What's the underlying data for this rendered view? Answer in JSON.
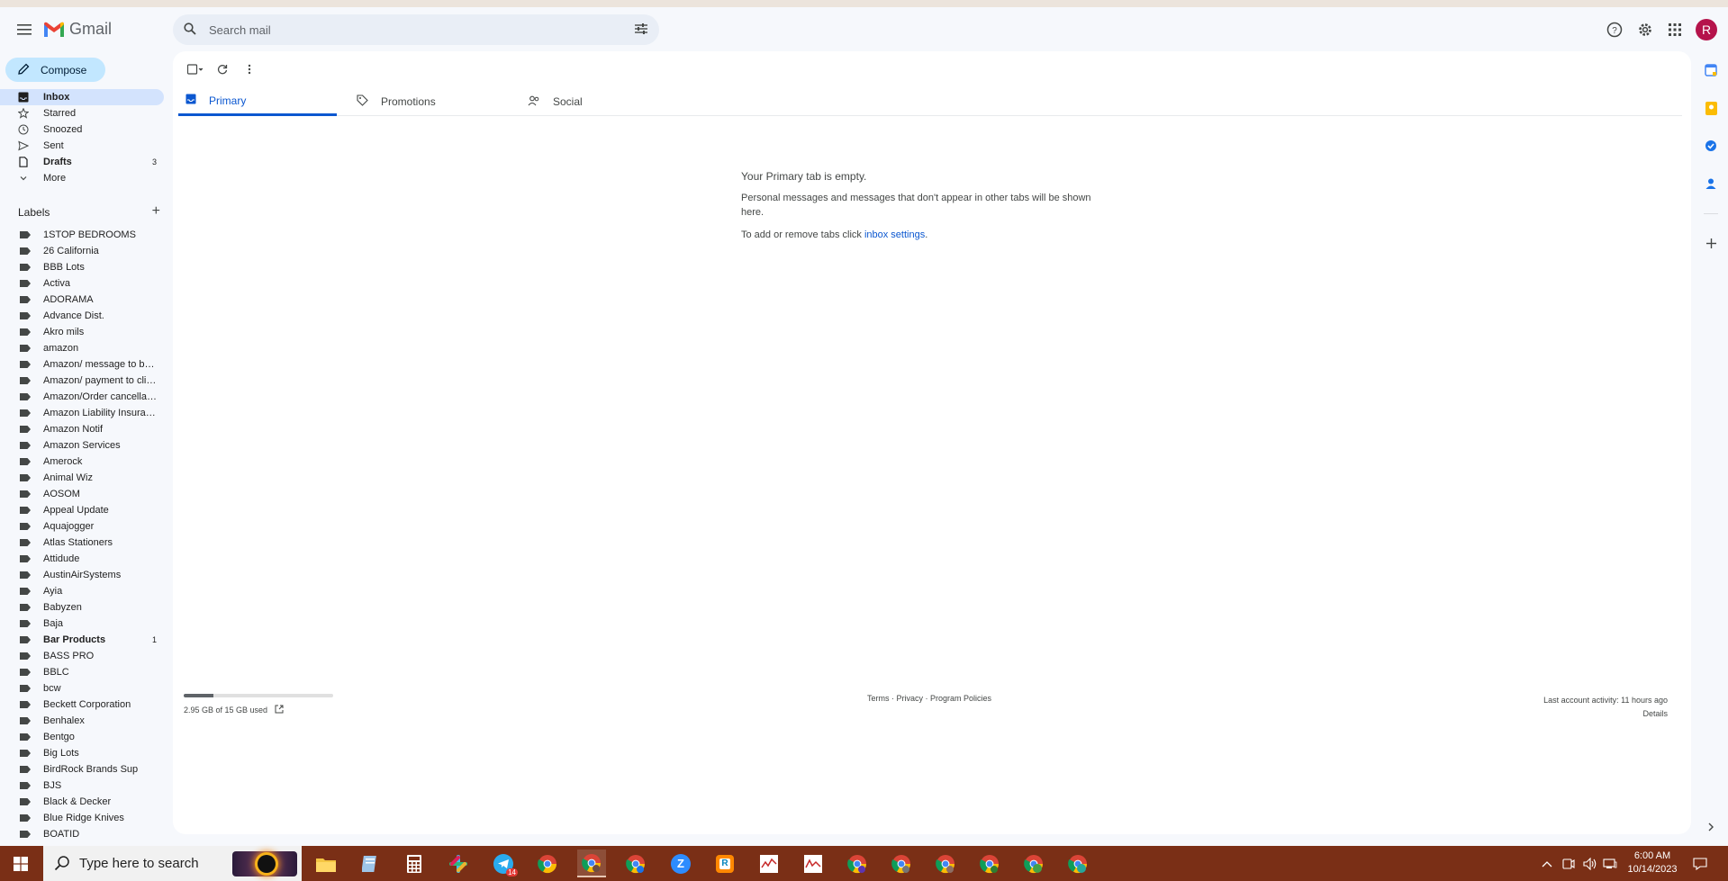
{
  "app": {
    "name": "Gmail"
  },
  "search": {
    "placeholder": "Search mail"
  },
  "compose": {
    "label": "Compose"
  },
  "nav": {
    "items": [
      {
        "label": "Inbox",
        "icon": "inbox-icon",
        "count": ""
      },
      {
        "label": "Starred",
        "icon": "star-icon",
        "count": ""
      },
      {
        "label": "Snoozed",
        "icon": "clock-icon",
        "count": ""
      },
      {
        "label": "Sent",
        "icon": "send-icon",
        "count": ""
      },
      {
        "label": "Drafts",
        "icon": "file-icon",
        "count": "3"
      },
      {
        "label": "More",
        "icon": "chevron-down-icon",
        "count": ""
      }
    ]
  },
  "labels": {
    "title": "Labels",
    "items": [
      {
        "label": "1STOP BEDROOMS",
        "count": ""
      },
      {
        "label": "26 California",
        "count": ""
      },
      {
        "label": "BBB Lots",
        "count": ""
      },
      {
        "label": "Activa",
        "count": ""
      },
      {
        "label": "ADORAMA",
        "count": ""
      },
      {
        "label": "Advance Dist.",
        "count": ""
      },
      {
        "label": "Akro mils",
        "count": ""
      },
      {
        "label": "amazon",
        "count": ""
      },
      {
        "label": "Amazon/ message to buyer",
        "count": ""
      },
      {
        "label": "Amazon/ payment to client",
        "count": ""
      },
      {
        "label": "Amazon/Order cancellation",
        "count": ""
      },
      {
        "label": "Amazon Liability Insurance",
        "count": ""
      },
      {
        "label": "Amazon Notif",
        "count": ""
      },
      {
        "label": "Amazon Services",
        "count": ""
      },
      {
        "label": "Amerock",
        "count": ""
      },
      {
        "label": "Animal Wiz",
        "count": ""
      },
      {
        "label": "AOSOM",
        "count": ""
      },
      {
        "label": "Appeal Update",
        "count": ""
      },
      {
        "label": "Aquajogger",
        "count": ""
      },
      {
        "label": "Atlas Stationers",
        "count": ""
      },
      {
        "label": "Attidude",
        "count": ""
      },
      {
        "label": "AustinAirSystems",
        "count": ""
      },
      {
        "label": "Ayia",
        "count": ""
      },
      {
        "label": "Babyzen",
        "count": ""
      },
      {
        "label": "Baja",
        "count": ""
      },
      {
        "label": "Bar Products",
        "count": "1"
      },
      {
        "label": "BASS PRO",
        "count": ""
      },
      {
        "label": "BBLC",
        "count": ""
      },
      {
        "label": "bcw",
        "count": ""
      },
      {
        "label": "Beckett Corporation",
        "count": ""
      },
      {
        "label": "Benhalex",
        "count": ""
      },
      {
        "label": "Bentgo",
        "count": ""
      },
      {
        "label": "Big Lots",
        "count": ""
      },
      {
        "label": "BirdRock Brands Sup",
        "count": ""
      },
      {
        "label": "BJS",
        "count": ""
      },
      {
        "label": "Black & Decker",
        "count": ""
      },
      {
        "label": "Blue Ridge Knives",
        "count": ""
      },
      {
        "label": "BOATID",
        "count": ""
      }
    ]
  },
  "tabs": [
    {
      "label": "Primary"
    },
    {
      "label": "Promotions"
    },
    {
      "label": "Social"
    }
  ],
  "empty": {
    "title": "Your Primary tab is empty.",
    "line1": "Personal messages and messages that don't appear in other tabs will be shown here.",
    "line2_prefix": "To add or remove tabs click ",
    "line2_link": "inbox settings",
    "line2_suffix": "."
  },
  "footer": {
    "storage_text": "2.95 GB of 15 GB used",
    "storage_fraction": 0.197,
    "links": "Terms · Privacy · Program Policies",
    "last_activity": "Last account activity: 11 hours ago",
    "details": "Details"
  },
  "avatar": {
    "initial": "R"
  },
  "taskbar": {
    "search_placeholder": "Type here to search",
    "time": "6:00 AM",
    "date": "10/14/2023",
    "telegram_badge": "14"
  },
  "colors": {
    "accent": "#0b57d0",
    "compose_bg": "#c2e7ff",
    "active_nav": "#d3e3fd",
    "avatar": "#b5134b",
    "taskbar": "#7a2f16"
  }
}
